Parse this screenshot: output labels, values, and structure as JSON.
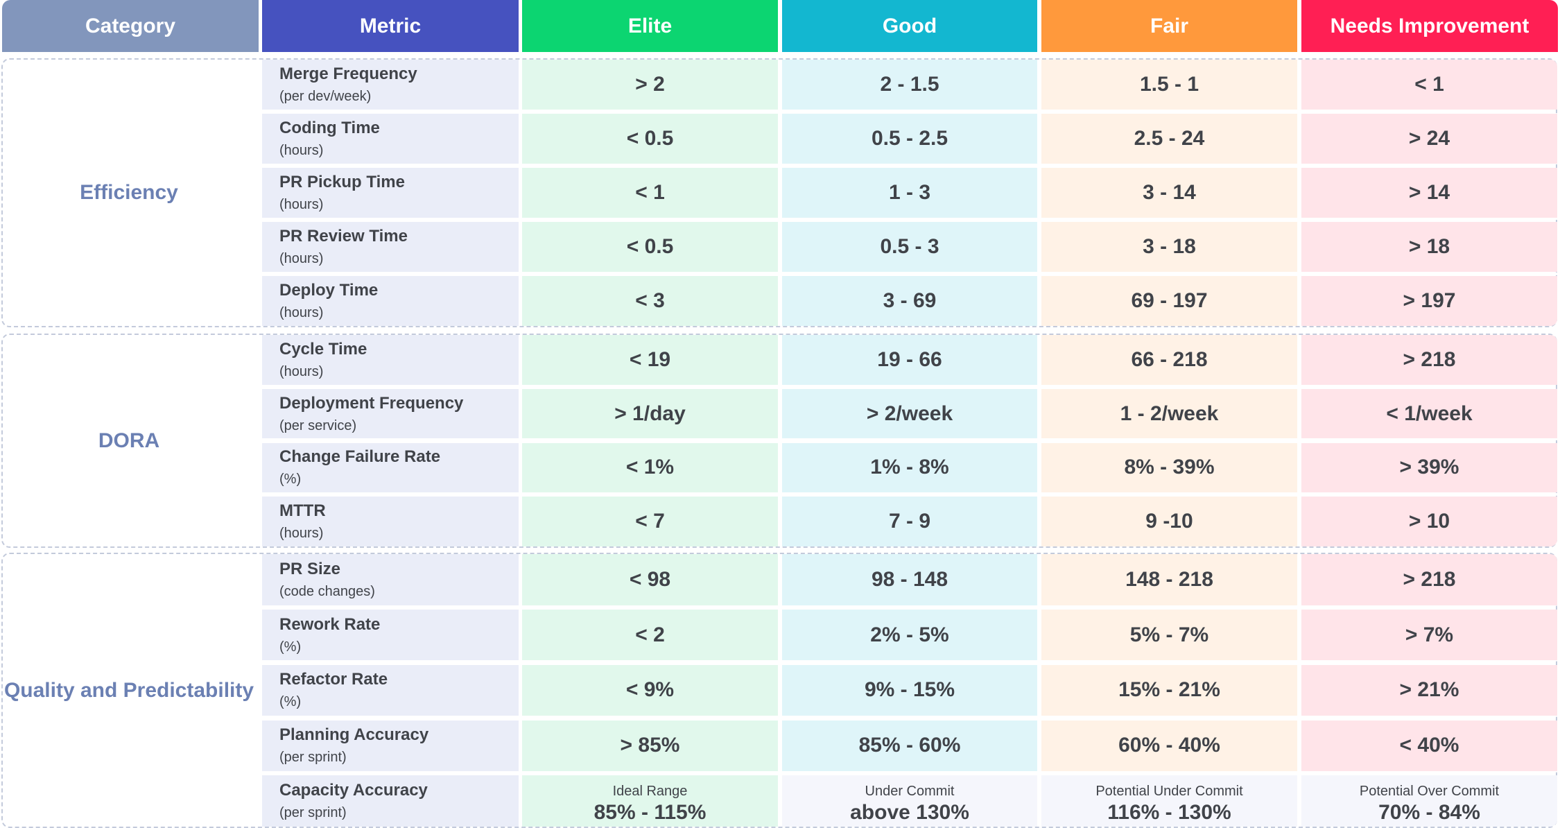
{
  "colors": {
    "category_header": "#8296bc",
    "metric_header": "#4652bf",
    "elite": "#0cd571",
    "good": "#13b7d0",
    "fair": "#ff993c",
    "needs_improvement": "#ff1f54",
    "category_text": "#6b80b3",
    "group_border": "#c3cadb"
  },
  "headers": {
    "category": "Category",
    "metric": "Metric",
    "elite": "Elite",
    "good": "Good",
    "fair": "Fair",
    "needs_improvement": "Needs Improvement"
  },
  "groups": [
    {
      "category": "Efficiency",
      "rows": [
        {
          "metric": "Merge Frequency",
          "unit": "(per dev/week)",
          "elite": "> 2",
          "good": "2 - 1.5",
          "fair": "1.5 - 1",
          "needs": "< 1"
        },
        {
          "metric": "Coding Time",
          "unit": "(hours)",
          "elite": "< 0.5",
          "good": "0.5 - 2.5",
          "fair": "2.5 - 24",
          "needs": "> 24"
        },
        {
          "metric": "PR Pickup Time",
          "unit": "(hours)",
          "elite": "< 1",
          "good": "1 - 3",
          "fair": "3 - 14",
          "needs": "> 14"
        },
        {
          "metric": "PR Review Time",
          "unit": "(hours)",
          "elite": "< 0.5",
          "good": "0.5 - 3",
          "fair": "3 - 18",
          "needs": "> 18"
        },
        {
          "metric": "Deploy Time",
          "unit": "(hours)",
          "elite": "< 3",
          "good": "3 - 69",
          "fair": "69 - 197",
          "needs": "> 197"
        }
      ]
    },
    {
      "category": "DORA",
      "rows": [
        {
          "metric": "Cycle Time",
          "unit": "(hours)",
          "elite": "< 19",
          "good": "19 - 66",
          "fair": "66 - 218",
          "needs": "> 218"
        },
        {
          "metric": "Deployment Frequency",
          "unit": "(per service)",
          "elite": "> 1/day",
          "good": "> 2/week",
          "fair": "1 - 2/week",
          "needs": "< 1/week"
        },
        {
          "metric": "Change Failure Rate",
          "unit": "(%)",
          "elite": "< 1%",
          "good": "1% - 8%",
          "fair": "8% - 39%",
          "needs": "> 39%"
        },
        {
          "metric": "MTTR",
          "unit": "(hours)",
          "elite": "< 7",
          "good": "7 - 9",
          "fair": "9 -10",
          "needs": "> 10"
        }
      ]
    },
    {
      "category": "Quality and Predictability",
      "rows": [
        {
          "metric": "PR Size",
          "unit": "(code changes)",
          "elite": "< 98",
          "good": "98 - 148",
          "fair": "148 - 218",
          "needs": "> 218"
        },
        {
          "metric": "Rework Rate",
          "unit": "(%)",
          "elite": "< 2",
          "good": "2% - 5%",
          "fair": "5% - 7%",
          "needs": "> 7%"
        },
        {
          "metric": "Refactor Rate",
          "unit": "(%)",
          "elite": "< 9%",
          "good": "9% - 15%",
          "fair": "15% - 21%",
          "needs": "> 21%"
        },
        {
          "metric": "Planning Accuracy",
          "unit": "(per sprint)",
          "elite": "> 85%",
          "good": "85% - 60%",
          "fair": "60% - 40%",
          "needs": "< 40%"
        },
        {
          "metric": "Capacity Accuracy",
          "unit": "(per sprint)",
          "elite": "85% - 115%",
          "elite_caption": "Ideal Range",
          "good": "above 130%",
          "good_caption": "Under Commit",
          "fair": "116% - 130%",
          "fair_caption": "Potential Under Commit",
          "needs": "70% - 84%",
          "needs_caption": "Potential Over Commit",
          "neutral": true
        }
      ]
    }
  ]
}
